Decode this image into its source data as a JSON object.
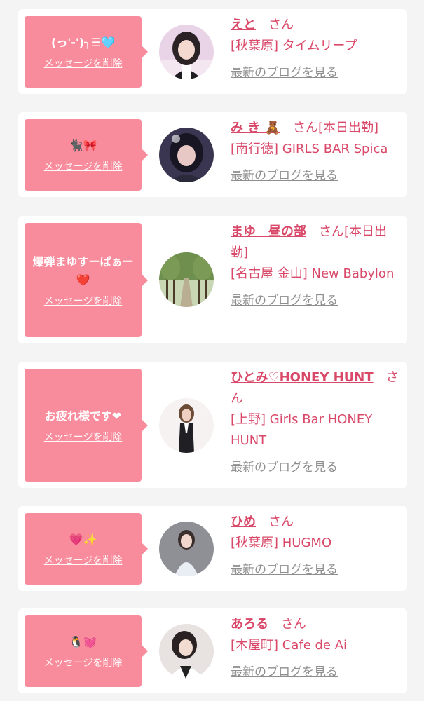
{
  "cards": [
    {
      "message": "(っ'-')╮☰🩵",
      "delete_label": "メッセージを削除",
      "name": "えと",
      "san": "さん",
      "status": "",
      "shop": "[秋葉原] タイムリープ",
      "blog_link": "最新のブログを見る",
      "avatar": "girl-photo-icon"
    },
    {
      "message": "🐈‍⬛🎀",
      "delete_label": "メッセージを削除",
      "name": "み き 🧸",
      "san": "さん",
      "status": "[本日出勤]",
      "shop": "[南行徳] GIRLS BAR Spica",
      "blog_link": "最新のブログを見る",
      "avatar": "girl-photo-icon"
    },
    {
      "message": "爆弾まゆすーぱぁー❤️",
      "delete_label": "メッセージを削除",
      "name": "まゆ　昼の部",
      "san": "さん",
      "status": "[本日出勤]",
      "shop": "[名古屋 金山] New Babylon",
      "blog_link": "最新のブログを見る",
      "avatar": "tree-photo-icon"
    },
    {
      "message": "お疲れ様です❤",
      "delete_label": "メッセージを削除",
      "name": "ひとみ♡HONEY HUNT",
      "san": "さん",
      "status": "",
      "shop": "[上野] Girls Bar HONEY HUNT",
      "blog_link": "最新のブログを見る",
      "avatar": "girl-photo-icon"
    },
    {
      "message": "💗✨",
      "delete_label": "メッセージを削除",
      "name": "ひめ",
      "san": "さん",
      "status": "",
      "shop": "[秋葉原] HUGMO",
      "blog_link": "最新のブログを見る",
      "avatar": "girl-photo-icon"
    },
    {
      "message": "🐧💓",
      "delete_label": "メッセージを削除",
      "name": "あろる",
      "san": "さん",
      "status": "",
      "shop": "[木屋町] Cafe de Ai",
      "blog_link": "最新のブログを見る",
      "avatar": "girl-photo-icon"
    }
  ]
}
